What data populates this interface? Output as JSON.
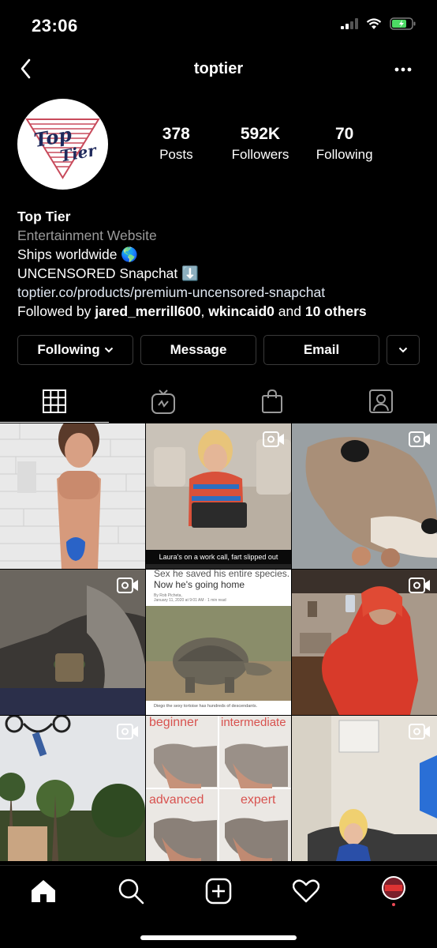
{
  "status": {
    "time": "23:06"
  },
  "header": {
    "username": "toptier"
  },
  "profile": {
    "stats": [
      {
        "value": "378",
        "label": "Posts"
      },
      {
        "value": "592K",
        "label": "Followers"
      },
      {
        "value": "70",
        "label": "Following"
      }
    ],
    "logo_text": {
      "line1": "Top",
      "line2": "Tier"
    },
    "name": "Top Tier",
    "category": "Entertainment Website",
    "bio_line1": "Ships worldwide 🌎",
    "bio_line2": "UNCENSORED Snapchat ⬇️",
    "link": "toptier.co/products/premium-uncensored-snapchat",
    "followed_by": {
      "prefix": "Followed by ",
      "user1": "jared_merrill600",
      "sep": ", ",
      "user2": "wkincaid0",
      "and": " and ",
      "others": "10 others"
    }
  },
  "buttons": {
    "following": "Following",
    "message": "Message",
    "email": "Email"
  },
  "tabs": [
    "grid-icon",
    "igtv-icon",
    "shop-icon",
    "tagged-icon"
  ],
  "posts": {
    "p2_caption": "Laura's on a work call, fart slipped out",
    "p5_head": "Sex he saved his entire species.",
    "p5_title": "Now he's going home",
    "p5_byline1": "By Rob Picheta,",
    "p5_byline2": "January 11, 2020 at 9:01 AM · 1 min read",
    "p5_caption": "Diego the sexy tortoise has hundreds of descendants.",
    "p8_labels": [
      "beginner",
      "intermediate",
      "advanced",
      "expert"
    ]
  },
  "colors": {
    "accent_red": "#ed4956",
    "link": "#e0e8f3",
    "muted": "#9a9a9a"
  }
}
